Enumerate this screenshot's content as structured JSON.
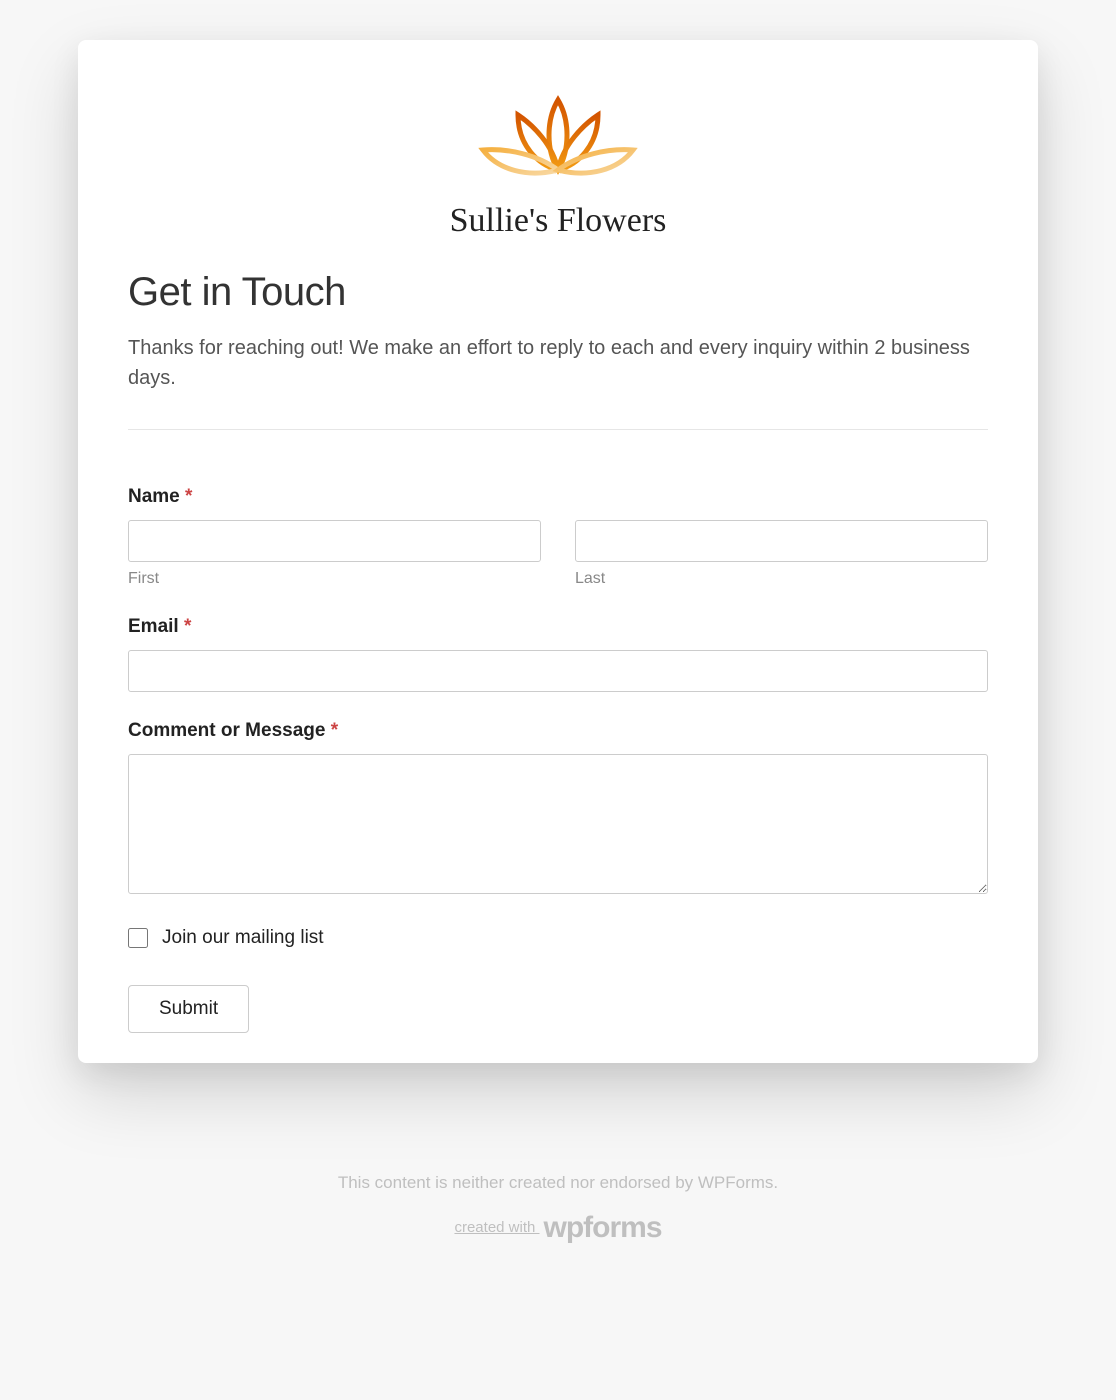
{
  "brand": {
    "name": "Sullie's Flowers"
  },
  "header": {
    "title": "Get in Touch",
    "intro": "Thanks for reaching out! We make an effort to reply to each and every inquiry within 2 business days."
  },
  "form": {
    "name": {
      "label": "Name",
      "required": "*",
      "first_value": "",
      "first_sublabel": "First",
      "last_value": "",
      "last_sublabel": "Last"
    },
    "email": {
      "label": "Email",
      "required": "*",
      "value": ""
    },
    "message": {
      "label": "Comment or Message",
      "required": "*",
      "value": ""
    },
    "mailing": {
      "label": "Join our mailing list",
      "checked": false
    },
    "submit": {
      "label": "Submit"
    }
  },
  "footer": {
    "disclaimer": "This content is neither created nor endorsed by WPForms.",
    "created_prefix": "created with ",
    "wpforms_text": "wpforms"
  }
}
